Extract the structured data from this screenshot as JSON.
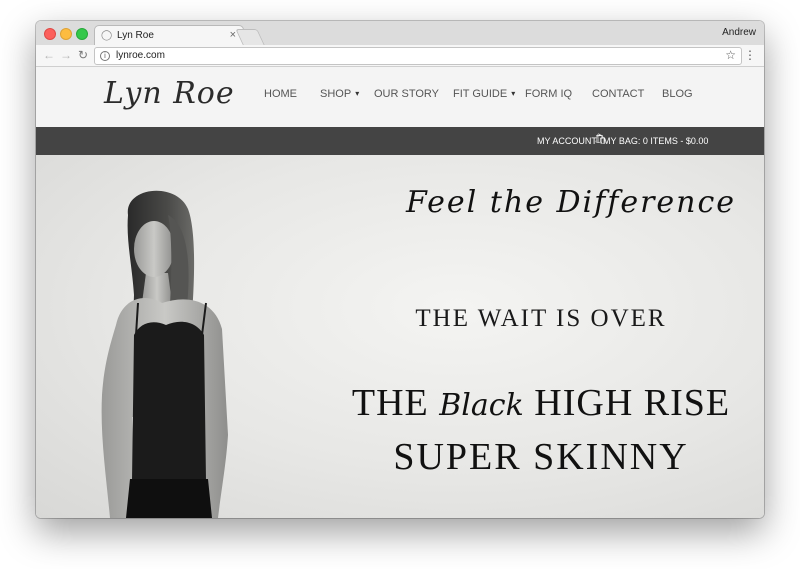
{
  "browser": {
    "tab_title": "Lyn Roe",
    "tab_close": "×",
    "user_name": "Andrew",
    "url": "lynroe.com",
    "back_glyph": "←",
    "forward_glyph": "→",
    "reload_glyph": "↻",
    "info_glyph": "i",
    "star_glyph": "☆",
    "menu_glyph": "⋮"
  },
  "site": {
    "logo_text": "Lyn Roe",
    "nav": [
      {
        "label": "HOME",
        "has_dropdown": false
      },
      {
        "label": "SHOP",
        "has_dropdown": true
      },
      {
        "label": "OUR STORY",
        "has_dropdown": false
      },
      {
        "label": "FIT GUIDE",
        "has_dropdown": true
      },
      {
        "label": "FORM IQ",
        "has_dropdown": false
      },
      {
        "label": "CONTACT",
        "has_dropdown": false
      },
      {
        "label": "BLOG",
        "has_dropdown": false
      }
    ],
    "caret_glyph": "▾",
    "account_bar": {
      "my_account": "MY ACCOUNT",
      "bag_icon": "bag-icon",
      "my_bag": "MY BAG: 0 ITEMS - $0.00"
    }
  },
  "hero": {
    "script_heading": "Feel the Difference",
    "line1": "THE WAIT IS OVER",
    "line2_pre": "THE",
    "line2_accent": "Black",
    "line2_post": "HIGH RISE",
    "line3": "SUPER SKINNY"
  },
  "colors": {
    "account_bar": "#444444",
    "header_bg": "#f4f4f4",
    "text_dark": "#111111"
  }
}
